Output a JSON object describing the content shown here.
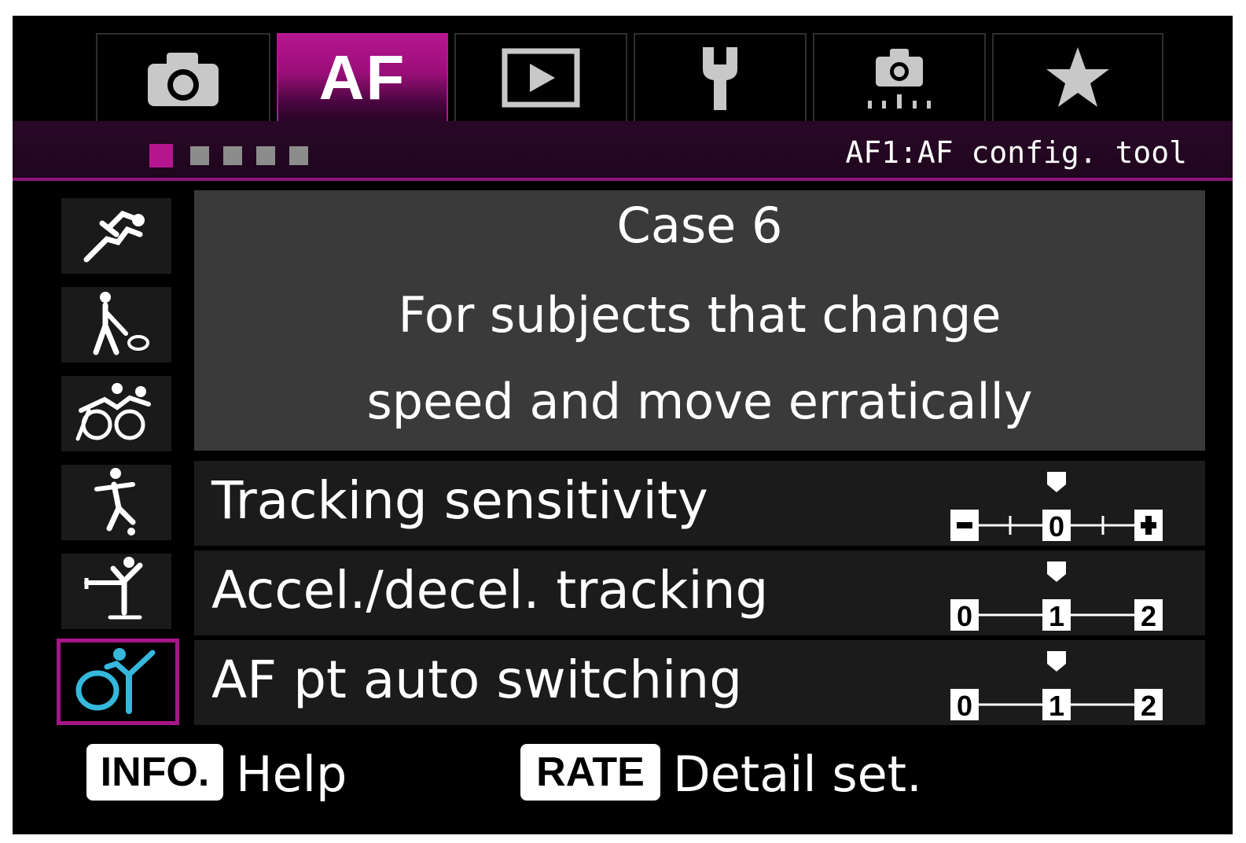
{
  "tabs": [
    {
      "id": "shooting",
      "icon": "camera-icon",
      "label": ""
    },
    {
      "id": "af",
      "icon": "",
      "label": "AF",
      "active": true
    },
    {
      "id": "playback",
      "icon": "play-icon",
      "label": ""
    },
    {
      "id": "setup",
      "icon": "wrench-icon",
      "label": ""
    },
    {
      "id": "custom",
      "icon": "camera-custom-icon",
      "label": ""
    },
    {
      "id": "mymenu",
      "icon": "star-icon",
      "label": ""
    }
  ],
  "header": {
    "title": "AF1:AF config. tool",
    "pages_total": 5,
    "page_active": 1
  },
  "sport_cases": [
    {
      "icon": "runner-icon",
      "selected": false
    },
    {
      "icon": "tennis-player-icon",
      "selected": false
    },
    {
      "icon": "cyclists-icon",
      "selected": false
    },
    {
      "icon": "soccer-player-icon",
      "selected": false
    },
    {
      "icon": "figure-skater-icon",
      "selected": false
    },
    {
      "icon": "gymnast-hoop-icon",
      "selected": true
    }
  ],
  "description": {
    "case_name": "Case 6",
    "line1": "For subjects that change",
    "line2": "speed and move erratically"
  },
  "parameters": [
    {
      "label": "Tracking sensitivity",
      "scale_type": "minus-plus",
      "ticks": [
        "−",
        "",
        "0",
        "",
        "+"
      ],
      "value": 0
    },
    {
      "label": "Accel./decel. tracking",
      "scale_type": "zero-two",
      "ticks": [
        "0",
        "1",
        "2"
      ],
      "value": 1
    },
    {
      "label": "AF pt auto switching",
      "scale_type": "zero-two",
      "ticks": [
        "0",
        "1",
        "2"
      ],
      "value": 1
    }
  ],
  "footer": {
    "info_key": "INFO.",
    "info_label": "Help",
    "rate_key": "RATE",
    "rate_label": "Detail set."
  },
  "colors": {
    "accent": "#b5168f",
    "selected_icon": "#35b8dc",
    "background": "#000000",
    "description_bg": "#3a3a3a",
    "row_bg": "#1b1b1b"
  }
}
